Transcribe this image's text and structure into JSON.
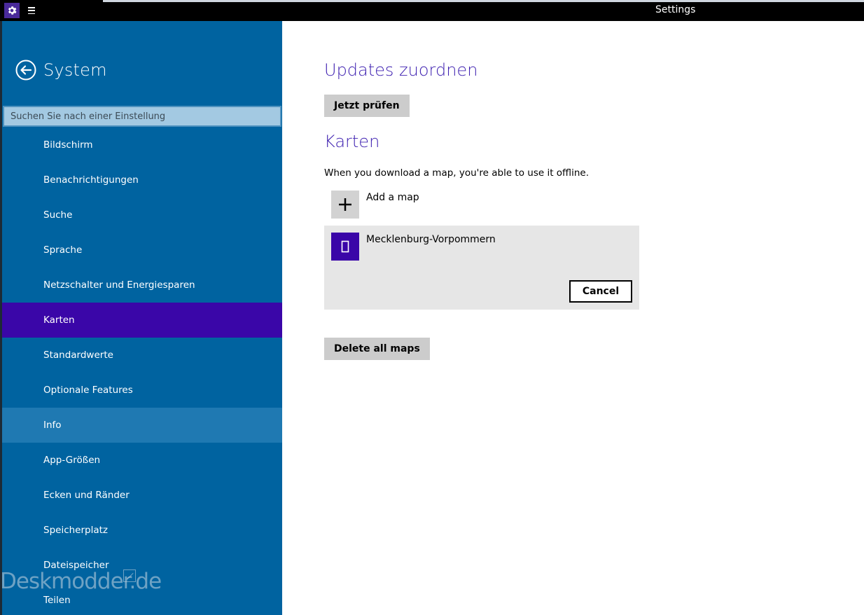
{
  "window": {
    "title": "Settings",
    "app_icon": "gear-icon",
    "menu_icon": "hamburger-icon"
  },
  "sidebar": {
    "back_icon": "back-arrow-icon",
    "title": "System",
    "search": {
      "placeholder": "Suchen Sie nach einer Einstellung",
      "value": ""
    },
    "selected": "Karten",
    "items": [
      {
        "label": "Bildschirm"
      },
      {
        "label": "Benachrichtigungen"
      },
      {
        "label": "Suche"
      },
      {
        "label": "Sprache"
      },
      {
        "label": "Netzschalter und Energiesparen"
      },
      {
        "label": "Karten"
      },
      {
        "label": "Standardwerte"
      },
      {
        "label": "Optionale Features"
      },
      {
        "label": "Info"
      },
      {
        "label": "App-Größen"
      },
      {
        "label": "Ecken und Ränder"
      },
      {
        "label": "Speicherplatz"
      },
      {
        "label": "Dateispeicher"
      },
      {
        "label": "Teilen"
      }
    ],
    "watermark": "Deskmodder.de"
  },
  "content": {
    "updates": {
      "heading": "Updates zuordnen",
      "check_button": "Jetzt prüfen"
    },
    "maps": {
      "heading": "Karten",
      "description": "When you download a map, you're able to use it offline.",
      "add_label": "Add a map",
      "add_icon": "plus-icon",
      "download": {
        "name": "Mecklenburg-Vorpommern",
        "icon": "map-icon",
        "cancel_label": "Cancel"
      },
      "delete_all_label": "Delete all maps"
    }
  },
  "colors": {
    "sidebar_bg": "#0063a0",
    "selected_bg": "#3a06a8",
    "accent_text": "#3d1fb0",
    "button_gray": "#cccccc"
  }
}
